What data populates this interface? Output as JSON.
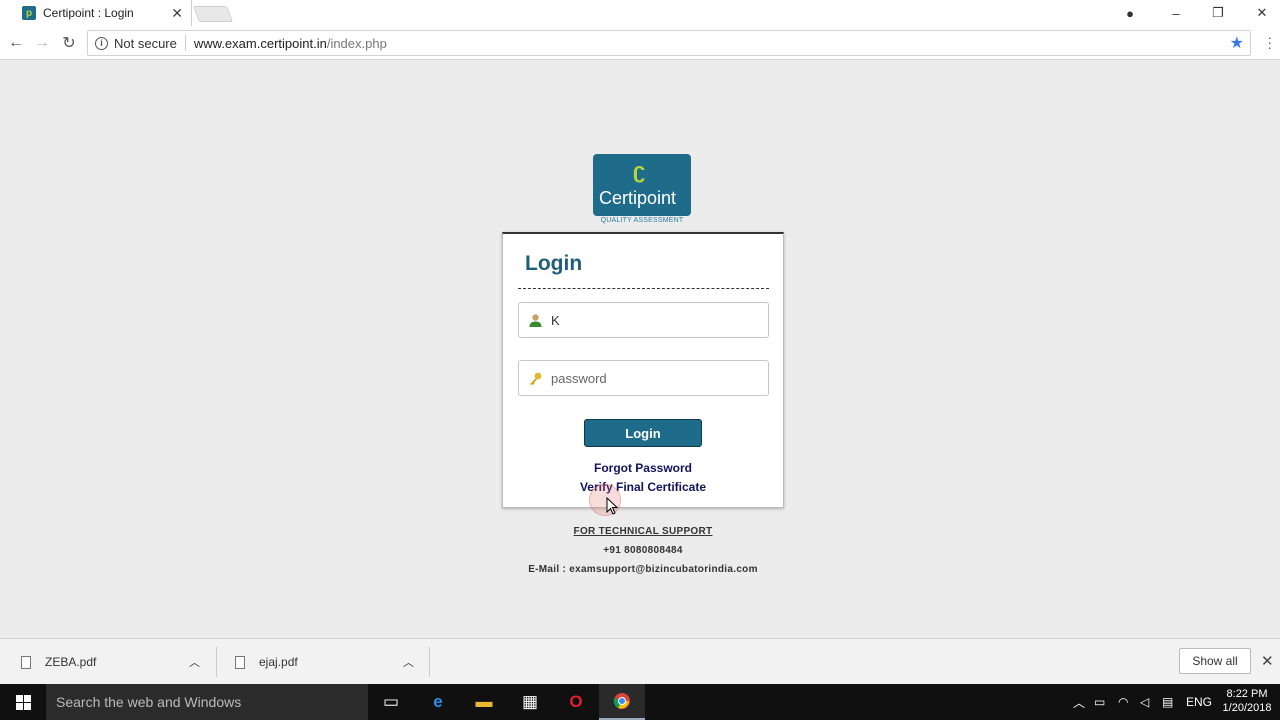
{
  "browser": {
    "tab_title": "Certipoint : Login",
    "security_label": "Not secure",
    "url_host": "www.exam.certipoint.in",
    "url_path": "/index.php"
  },
  "logo": {
    "name": "Certipoint",
    "tagline": "QUALITY ASSESSMENT"
  },
  "login": {
    "heading": "Login",
    "username_value": "K",
    "password_placeholder": "password",
    "button_label": "Login",
    "forgot_link": "Forgot Password",
    "verify_link": "Verify Final Certificate"
  },
  "support": {
    "heading": "FOR TECHNICAL SUPPORT",
    "phone": "+91 8080808484",
    "email": "E-Mail : examsupport@bizincubatorindia.com"
  },
  "downloads": {
    "items": [
      {
        "name": "ZEBA.pdf"
      },
      {
        "name": "ejaj.pdf"
      }
    ],
    "show_all": "Show all"
  },
  "taskbar": {
    "search_placeholder": "Search the web and Windows",
    "language": "ENG",
    "time": "8:22 PM",
    "date": "1/20/2018"
  }
}
